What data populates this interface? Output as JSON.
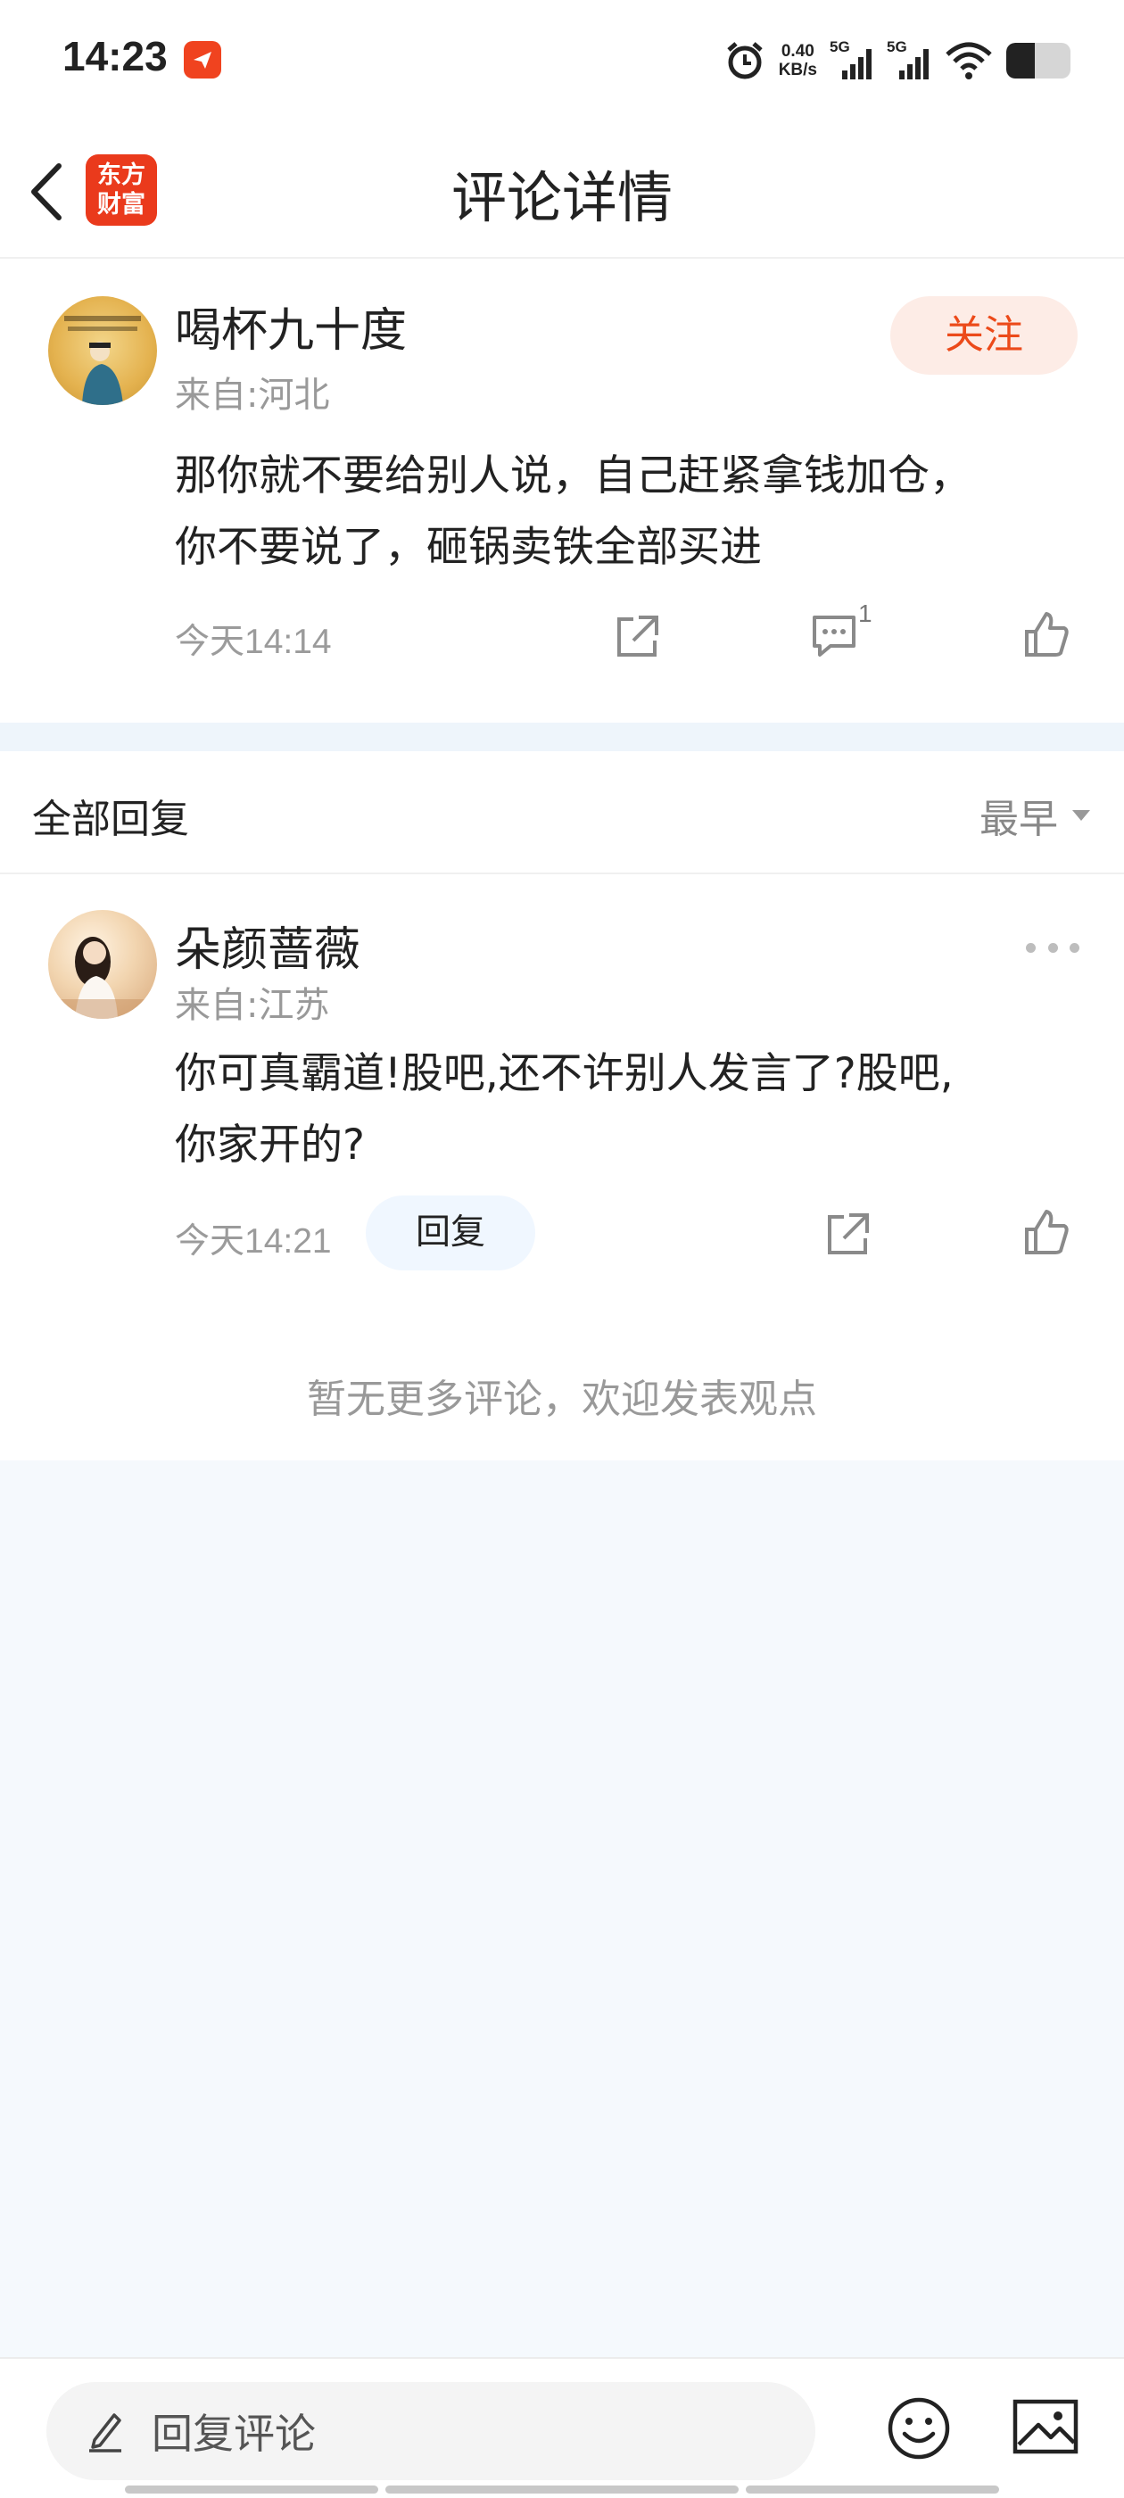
{
  "status_bar": {
    "time": "14:23",
    "net_speed_value": "0.40",
    "net_speed_unit": "KB/s",
    "signal_1": "5G",
    "signal_2": "5G",
    "battery_level": 0.45,
    "icons": [
      "app-notification-icon",
      "alarm-icon",
      "signal-icon",
      "wifi-icon",
      "battery-icon"
    ]
  },
  "header": {
    "title": "评论详情",
    "logo_line1": "东方",
    "logo_line2": "财富"
  },
  "comment": {
    "username": "喝杯九十度",
    "location": "来自:河北",
    "follow_label": "关注",
    "content_line1": "那你就不要给别人说，自己赶紧拿钱加仓，",
    "content_line2": "你不要说了，砸锅卖铁全部买进",
    "time": "今天14:14",
    "reply_count": "1"
  },
  "replies_section": {
    "title": "全部回复",
    "sort_label": "最早"
  },
  "reply": {
    "username": "朵颜蔷薇",
    "location": "来自:江苏",
    "content_line1": "你可真霸道!股吧,还不许别人发言了?股吧,",
    "content_line2": "你家开的?",
    "time": "今天14:21",
    "reply_button_label": "回复"
  },
  "no_more_text": "暂无更多评论，欢迎发表观点",
  "bottom_bar": {
    "input_placeholder": "回复评论"
  },
  "colors": {
    "accent": "#ec4a1a",
    "follow_bg": "#fdece6",
    "page_bg": "#f5f9fd"
  }
}
